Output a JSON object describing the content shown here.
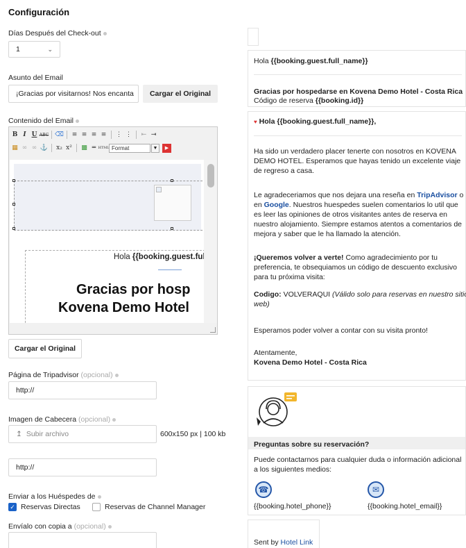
{
  "config": {
    "title": "Configuración",
    "checkout_label": "Días Después del Check-out",
    "checkout_value": "1",
    "subject_label": "Asunto del Email",
    "subject_value": "¡Gracias por visitarnos! Nos encanta",
    "load_original": "Cargar el Original",
    "content_label": "Contenido del Email",
    "editor": {
      "format_label": "Format",
      "preview_greeting": "Hola",
      "preview_name": "{{booking.guest.ful",
      "preview_heading1": "Gracias por hosp",
      "preview_heading2": "Kovena Demo Hotel"
    },
    "load_original_2": "Cargar el Original",
    "tripadvisor_label": "Página de Tripadvisor",
    "optional": "(opcional)",
    "tripadvisor_value": "http://",
    "header_image_label": "Imagen de Cabecera",
    "upload_label": "Subir archivo",
    "image_size_hint": "600x150 px | 100 kb",
    "header_url_value": "http://",
    "send_to_label": "Enviar a los Huéspedes de",
    "direct_bookings": "Reservas Directas",
    "direct_checked": true,
    "channel_bookings": "Reservas de Channel Manager",
    "channel_checked": false,
    "cc_label": "Envíalo con copia a",
    "cc_value": ""
  },
  "preview": {
    "hello_prefix": "Hola",
    "guest_var": "{{booking.guest.full_name}}",
    "thanks_line": "Gracias por hospedarse en Kovena Demo Hotel - Costa Rica",
    "code_prefix": "Código de reserva",
    "booking_id_var": "{{booking.id}}",
    "greeting_prefix": "Hola",
    "greeting_var": "{{booking.guest.full_name}},",
    "p1": "Ha sido un verdadero placer tenerte con nosotros en KOVENA DEMO HOTEL.  Esperamos que hayas tenido un excelente viaje de regreso a casa.",
    "p2_a": "Le agradeceriamos que nos dejara una reseña en",
    "p2_tripadvisor": "TripAdvisor",
    "p2_b": "o en",
    "p2_google": "Google",
    "p2_c": ". Nuestros huespedes suelen comentarios lo util que es leer las opiniones de otros visitantes antes de reserva en nuestro alojamiento. Siempre estamos atentos a comentarios de mejora y saber que le ha llamado la atención.",
    "p3_bold": "¡Queremos volver a verte!",
    "p3_rest": " Como agradecimiento por tu preferencia, te obsequiamos un código de descuento exclusivo para tu próxima visita:",
    "p4_bold": "Codigo:",
    "p4_code": " VOLVERAQUI ",
    "p4_italic": "(Válido solo para reservas en nuestro sitio web)",
    "p5": "Esperamos poder volver a contar con  su visita pronto!",
    "sign_1": "Atentamente,",
    "sign_2": "Kovena Demo Hotel - Costa Rica",
    "questions_title": "Preguntas sobre su reservación?",
    "questions_text": "Puede contactarnos para cualquier duda o información adicional a los siguientes medios:",
    "phone_var": "{{booking.hotel_phone}}",
    "email_var": "{{booking.hotel_email}}",
    "sent_by": "Sent by",
    "sent_by_link": "Hotel Link"
  },
  "colors": {
    "accent": "#1a62c8",
    "link": "#1a4fa0",
    "contact_icon": "#2456a8"
  }
}
